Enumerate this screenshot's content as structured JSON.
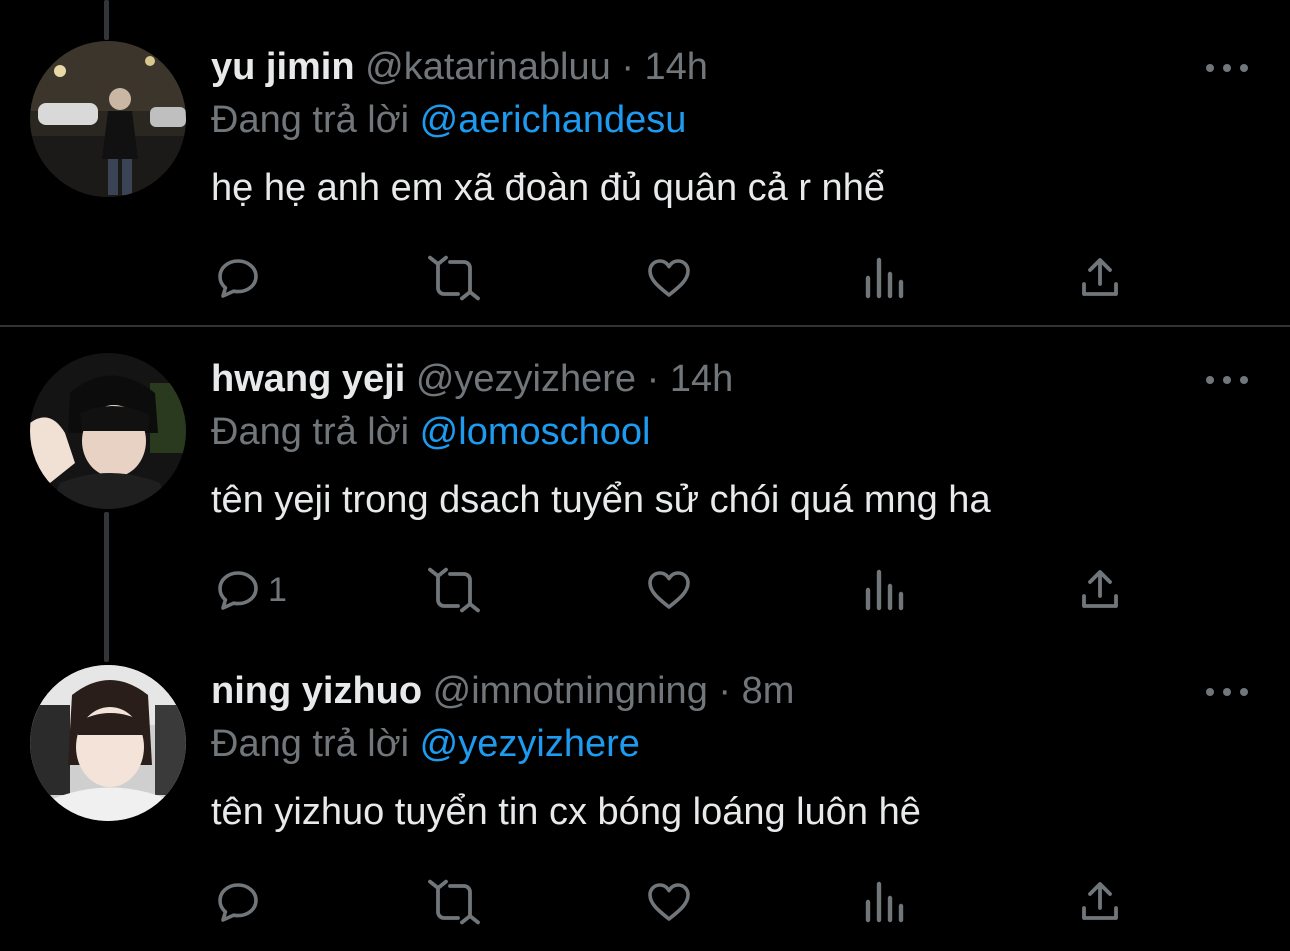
{
  "tweets": [
    {
      "name": "yu jimin",
      "handle": "@katarinabluu",
      "separator": "·",
      "time": "14h",
      "reply_prefix": "Đang trả lời ",
      "reply_to": "@aerichandesu",
      "text": "hẹ hẹ anh em xã đoàn đủ quân cả r nhể",
      "actions": {
        "reply_count": "",
        "retweet_count": "",
        "like_count": "",
        "views_count": ""
      }
    },
    {
      "name": "hwang yeji",
      "handle": "@yezyizhere",
      "separator": "·",
      "time": "14h",
      "reply_prefix": "Đang trả lời ",
      "reply_to": "@lomoschool",
      "text": "tên yeji trong dsach tuyển sử chói quá mng ha",
      "actions": {
        "reply_count": "1",
        "retweet_count": "",
        "like_count": "",
        "views_count": ""
      }
    },
    {
      "name": "ning yizhuo",
      "handle": "@imnotningning",
      "separator": "·",
      "time": "8m",
      "reply_prefix": "Đang trả lời ",
      "reply_to": "@yezyizhere",
      "text": "tên yizhuo tuyển tin cx bóng loáng luôn hê",
      "actions": {
        "reply_count": "",
        "retweet_count": "",
        "like_count": "",
        "views_count": ""
      }
    }
  ],
  "colors": {
    "background": "#000000",
    "primary_text": "#e7e9ea",
    "secondary_text": "#71767b",
    "accent": "#1d9bf0",
    "divider": "#2f3336"
  },
  "icons": [
    "reply-icon",
    "retweet-icon",
    "like-icon",
    "views-icon",
    "share-icon",
    "more-icon"
  ]
}
